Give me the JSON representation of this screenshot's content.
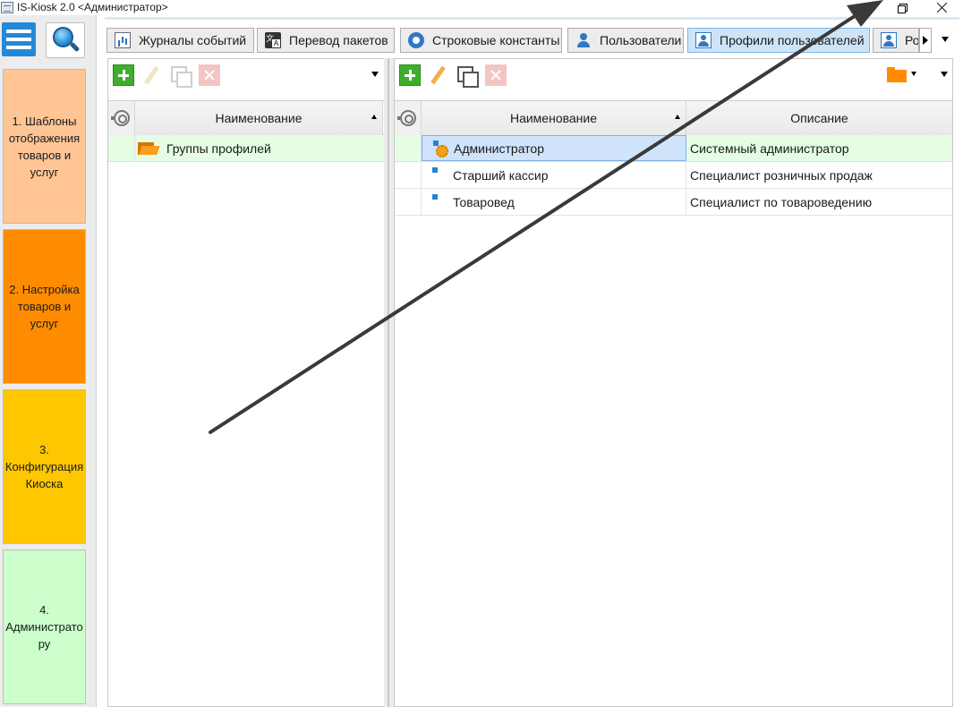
{
  "window": {
    "title": "IS-Kiosk 2.0 <Администратор>",
    "controls": {
      "minimize": "minimize-icon",
      "restore": "restore-icon",
      "close": "close-icon"
    }
  },
  "sidebar": {
    "menu_icon": "hamburger-icon",
    "search_icon": "search-icon",
    "tiles": [
      {
        "label": "1. Шаблоны отображения товаров и услуг",
        "color": "#ffc594"
      },
      {
        "label": "2. Настройка товаров и услуг",
        "color": "#ff8c00"
      },
      {
        "label": "3. Конфигурация Киоска",
        "color": "#ffc700"
      },
      {
        "label": "4. Администрато ру",
        "color": "#ccffcc"
      }
    ]
  },
  "tabs": [
    {
      "label": "Журналы событий",
      "icon": "journal-icon"
    },
    {
      "label": "Перевод пакетов",
      "icon": "translate-icon"
    },
    {
      "label": "Строковые константы",
      "icon": "gear-icon"
    },
    {
      "label": "Пользователи",
      "icon": "user-icon"
    },
    {
      "label": "Профили пользователей",
      "icon": "profile-icon",
      "active": true
    },
    {
      "label": "Ро",
      "icon": "profile-icon"
    }
  ],
  "left_pane": {
    "columns": [
      "Наименование"
    ],
    "rows": [
      {
        "name": "Группы профилей",
        "icon": "folder-open-icon"
      }
    ]
  },
  "right_pane": {
    "columns": [
      "Наименование",
      "Описание"
    ],
    "rows": [
      {
        "name": "Администратор",
        "description": "Системный администратор",
        "selected": true
      },
      {
        "name": "Старший кассир",
        "description": "Специалист розничных продаж"
      },
      {
        "name": "Товаровед",
        "description": "Специалист по товароведению"
      }
    ]
  },
  "colors": {
    "accent": "#2389d7",
    "selection_row": "#e5fde5",
    "selection_cell": "#cfe3fb",
    "active_tab": "#cde4f7",
    "annotation_arrow": "#3a3a3a"
  }
}
